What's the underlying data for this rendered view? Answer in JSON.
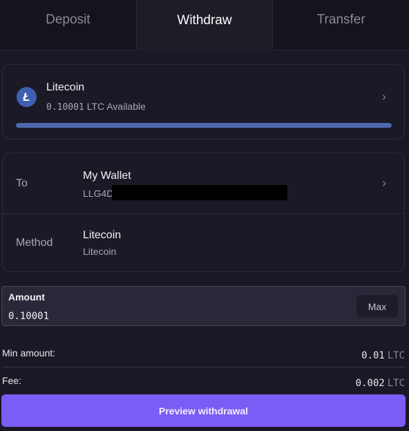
{
  "tabs": [
    {
      "label": "Deposit"
    },
    {
      "label": "Withdraw"
    },
    {
      "label": "Transfer"
    }
  ],
  "asset": {
    "name": "Litecoin",
    "available_amount": "0.10001",
    "available_unit": "LTC Available",
    "icon": "litecoin-icon",
    "icon_glyph": "Ł",
    "progress": 1.0
  },
  "destination": {
    "to_label": "To",
    "wallet_name": "My Wallet",
    "address_prefix": "LLG4D",
    "method_label": "Method",
    "method_name": "Litecoin",
    "method_network": "Litecoin"
  },
  "amount": {
    "label": "Amount",
    "value": "0.10001",
    "max_label": "Max"
  },
  "fees": {
    "min_label": "Min amount:",
    "min_value": "0.01",
    "min_unit": "LTC",
    "fee_label": "Fee:",
    "fee_value": "0.002",
    "fee_unit": "LTC"
  },
  "actions": {
    "preview_label": "Preview withdrawal"
  },
  "colors": {
    "accent": "#7b5cf5",
    "progress": "#4e6aaf",
    "background": "#1a1824"
  }
}
